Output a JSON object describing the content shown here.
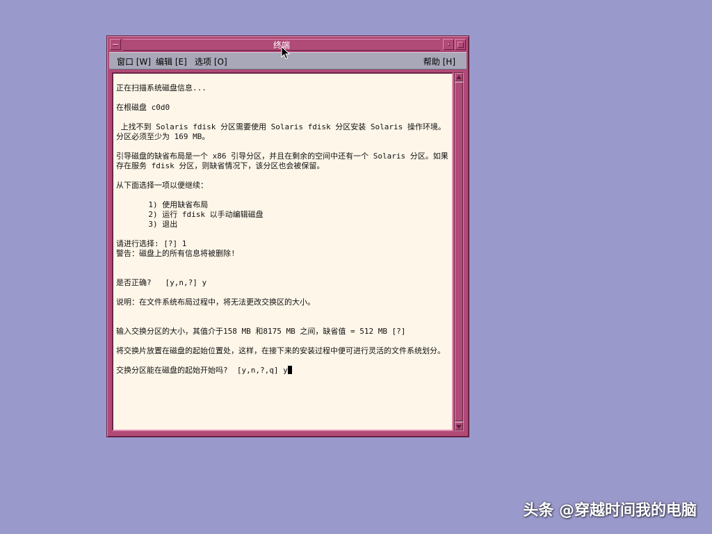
{
  "window": {
    "title": "终端"
  },
  "menubar": {
    "window_menu": "窗口 [W]",
    "edit_menu": "编辑 [E]",
    "options_menu": "选项 [O]",
    "help_menu": "帮助 [H]"
  },
  "terminal": {
    "text": "正在扫描系统磁盘信息...\n\n在根磁盘 c0d0\n\n 上找不到 Solaris fdisk 分区需要使用 Solaris fdisk 分区安装 Solaris 操作环境。分区必须至少为 169 MB。\n\n引导磁盘的缺省布局是一个 x86 引导分区，并且在剩余的空间中还有一个 Solaris 分区。如果存在服务 fdisk 分区，则缺省情况下，该分区也会被保留。\n\n从下面选择一项以便继续：\n\n       1) 使用缺省布局\n       2) 运行 fdisk 以手动编辑磁盘\n       3) 退出\n\n请进行选择: [?] 1\n警告：磁盘上的所有信息将被删除!\n\n\n是否正确?   [y,n,?] y\n\n说明：在文件系统布局过程中，将无法更改交换区的大小。\n\n\n输入交换分区的大小，其值介于158 MB 和8175 MB 之间，缺省值 = 512 MB [?]\n\n将交换片放置在磁盘的起始位置处，这样，在接下来的安装过程中便可进行灵活的文件系统划分。\n\n交换分区能在磁盘的起始开始吗?  [y,n,?,q] y"
  },
  "icons": {
    "window_menu_button": "window-menu-icon",
    "minimize_button": "minimize-icon",
    "maximize_button": "maximize-icon",
    "scroll_up": "arrow-up-icon",
    "scroll_down": "arrow-down-icon",
    "mouse": "mouse-pointer-icon"
  },
  "colors": {
    "desktop": "#9a99cb",
    "window_frame": "#b04a77",
    "menubar": "#a8a8b8",
    "terminal_bg": "#fdf6e9",
    "terminal_fg": "#111111"
  },
  "watermark": "头条 @穿越时间我的电脑"
}
